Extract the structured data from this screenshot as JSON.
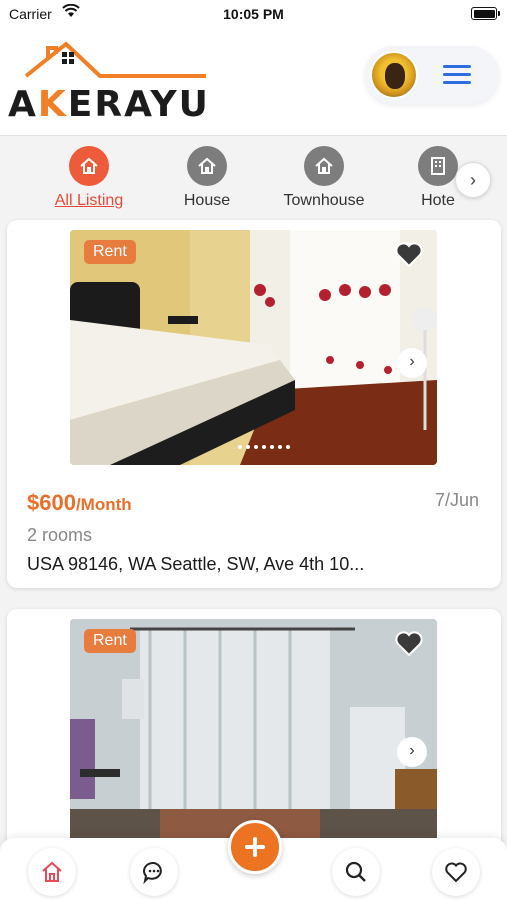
{
  "status": {
    "carrier": "Carrier",
    "time": "10:05 PM"
  },
  "brand": {
    "name_start": "A",
    "name_k": "K",
    "name_end": "ERAYU"
  },
  "colors": {
    "accent": "#ec7322",
    "menu": "#2d6ee0",
    "active_category": "#ee5b3a"
  },
  "categories": [
    {
      "label": "All Listing",
      "icon": "home-icon",
      "active": true
    },
    {
      "label": "House",
      "icon": "home-icon",
      "active": false
    },
    {
      "label": "Townhouse",
      "icon": "home-icon",
      "active": false
    },
    {
      "label": "Hote",
      "icon": "building-icon",
      "active": false
    }
  ],
  "listings": [
    {
      "badge": "Rent",
      "price": "$600",
      "period": "/Month",
      "date": "7/Jun",
      "rooms": "2 rooms",
      "address": "USA 98146, WA Seattle, SW, Ave 4th 10..."
    },
    {
      "badge": "Rent"
    }
  ],
  "tabs": [
    "home-icon",
    "chat-icon",
    "add-icon",
    "search-icon",
    "heart-icon"
  ]
}
